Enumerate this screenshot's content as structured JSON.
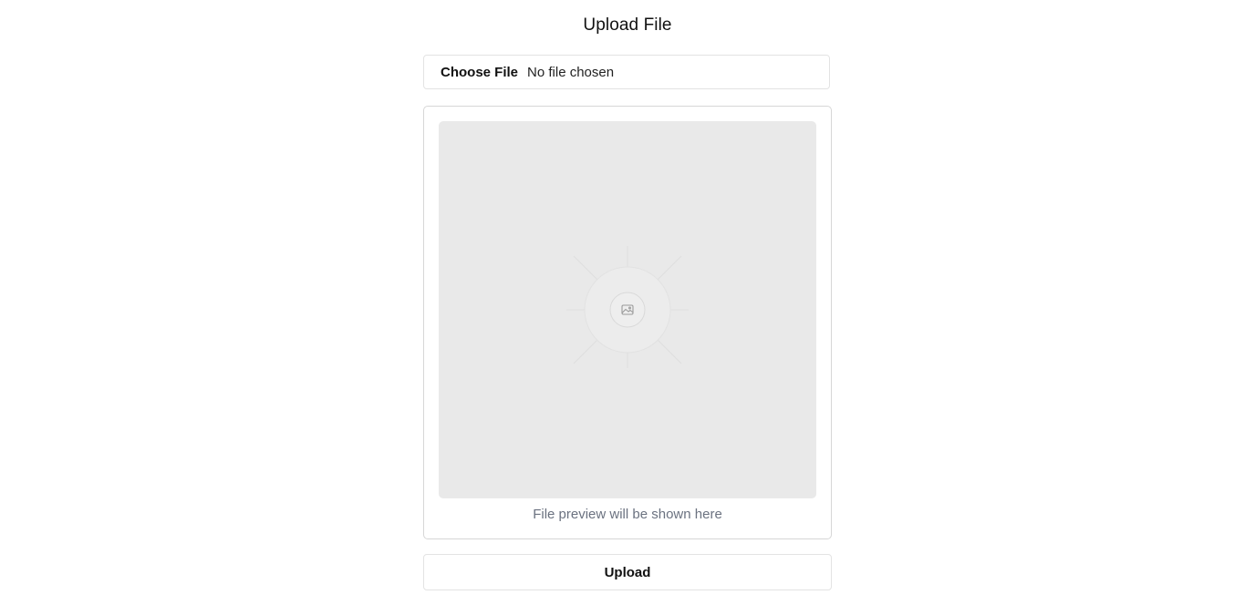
{
  "page": {
    "title": "Upload File"
  },
  "file_input": {
    "button_label": "Choose File",
    "status_text": "No file chosen"
  },
  "preview": {
    "caption": "File preview will be shown here",
    "icon": "image-icon"
  },
  "actions": {
    "upload_label": "Upload"
  },
  "colors": {
    "preview_background": "#e9e9e9",
    "caption_text": "#6b7280",
    "border": "#d6d6d6"
  }
}
